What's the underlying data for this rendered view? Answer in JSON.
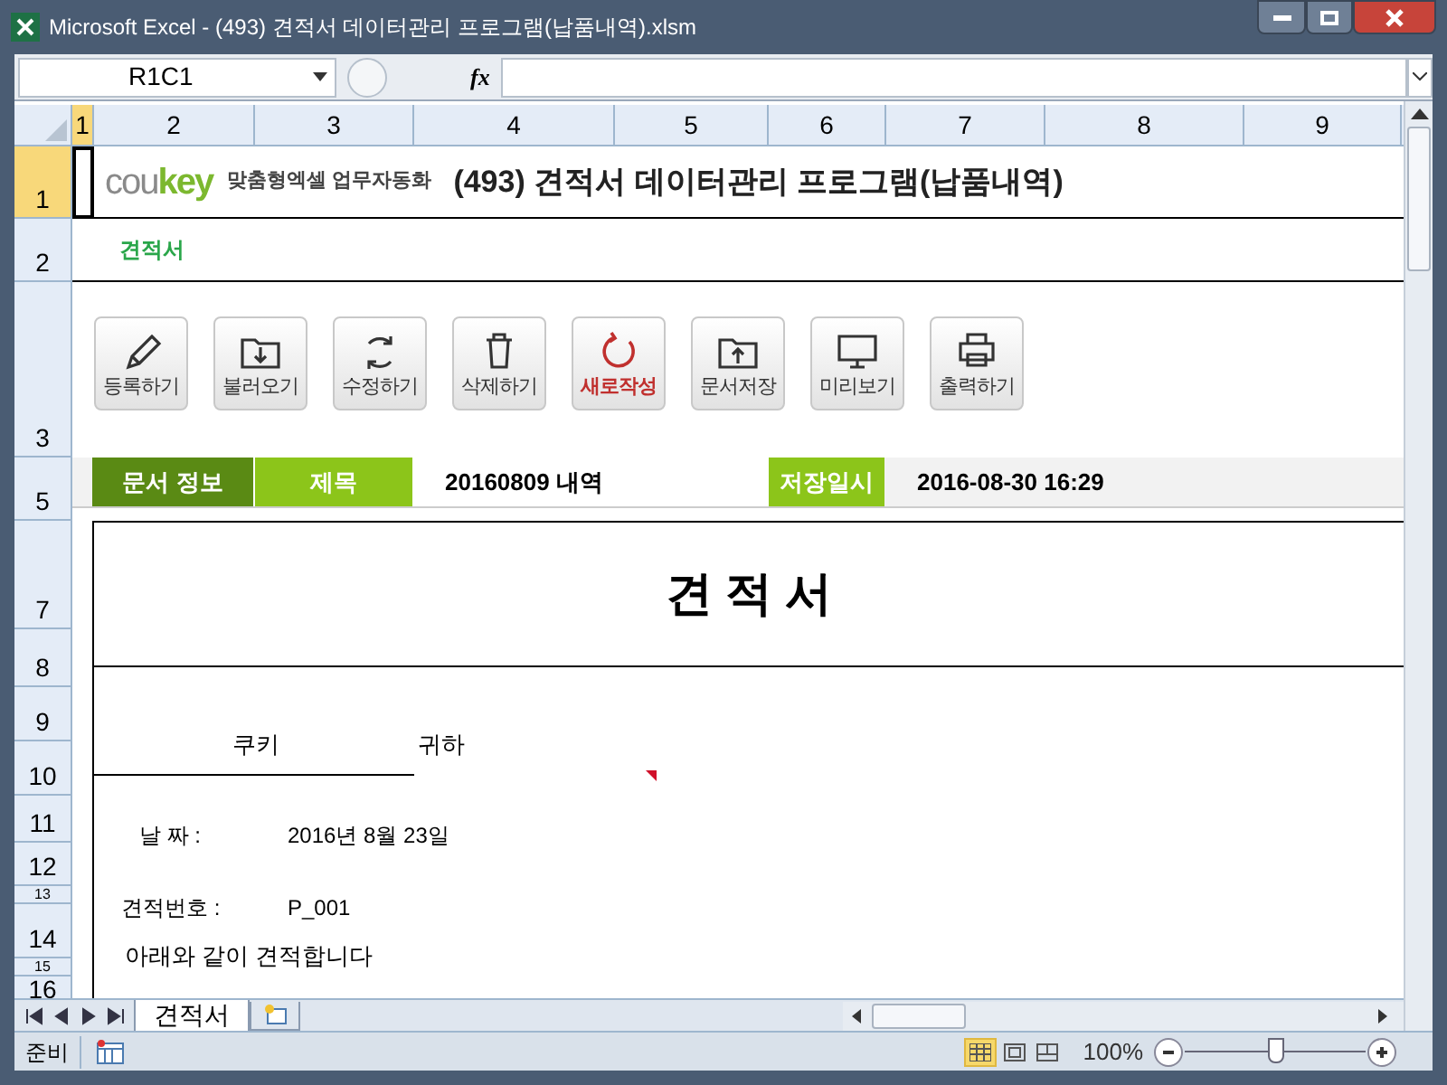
{
  "window": {
    "title": "Microsoft Excel - (493) 견적서 데이터관리 프로그램(납품내역).xlsm"
  },
  "formula_bar": {
    "name_box": "R1C1",
    "fx": "fx"
  },
  "columns": [
    {
      "label": "1",
      "selected": true
    },
    {
      "label": "2",
      "selected": false
    },
    {
      "label": "3",
      "selected": false
    },
    {
      "label": "4",
      "selected": false
    },
    {
      "label": "5",
      "selected": false
    },
    {
      "label": "6",
      "selected": false
    },
    {
      "label": "7",
      "selected": false
    },
    {
      "label": "8",
      "selected": false
    },
    {
      "label": "9",
      "selected": false
    }
  ],
  "rows": [
    {
      "label": "1",
      "selected": true
    },
    {
      "label": "2",
      "selected": false
    },
    {
      "label": "3",
      "selected": false
    },
    {
      "label": "5",
      "selected": false
    },
    {
      "label": "7",
      "selected": false
    },
    {
      "label": "8",
      "selected": false
    },
    {
      "label": "9",
      "selected": false
    },
    {
      "label": "10",
      "selected": false
    },
    {
      "label": "11",
      "selected": false
    },
    {
      "label": "12",
      "selected": false
    },
    {
      "label": "13",
      "selected": false
    },
    {
      "label": "14",
      "selected": false
    },
    {
      "label": "15",
      "selected": false
    },
    {
      "label": "16",
      "selected": false
    }
  ],
  "sheet": {
    "logo_cou": "cou",
    "logo_key": "key",
    "tagline": "맞춤형엑셀 업무자동화",
    "title": "(493) 견적서 데이터관리 프로그램(납품내역)",
    "subtitle": "견적서",
    "buttons": [
      {
        "kind": "pencil",
        "label": "등록하기",
        "highlighted": false
      },
      {
        "kind": "folder-down",
        "label": "불러오기",
        "highlighted": false
      },
      {
        "kind": "refresh",
        "label": "수정하기",
        "highlighted": false
      },
      {
        "kind": "trash",
        "label": "삭제하기",
        "highlighted": false
      },
      {
        "kind": "circle-arrow",
        "label": "새로작성",
        "highlighted": true
      },
      {
        "kind": "folder-up",
        "label": "문서저장",
        "highlighted": false
      },
      {
        "kind": "monitor",
        "label": "미리보기",
        "highlighted": false
      },
      {
        "kind": "printer",
        "label": "출력하기",
        "highlighted": false
      }
    ],
    "info": {
      "section": "문서 정보",
      "title_label": "제목",
      "title_value": "20160809 내역",
      "saved_label": "저장일시",
      "saved_value": "2016-08-30 16:29"
    },
    "doc_title": "견 적 서",
    "recipient": "쿠키",
    "honorific": "귀하",
    "date_label": "날 짜 :",
    "date_value": "2016년 8월 23일",
    "number_label": "견적번호 :",
    "number_value": "P_001",
    "intro": "아래와 같이 견적합니다"
  },
  "sheet_tabs": [
    {
      "label": "견적서",
      "selected": true
    }
  ],
  "status_bar": {
    "status": "준비",
    "zoom": "100%",
    "zoom_slider": {
      "level": 0.5
    }
  }
}
